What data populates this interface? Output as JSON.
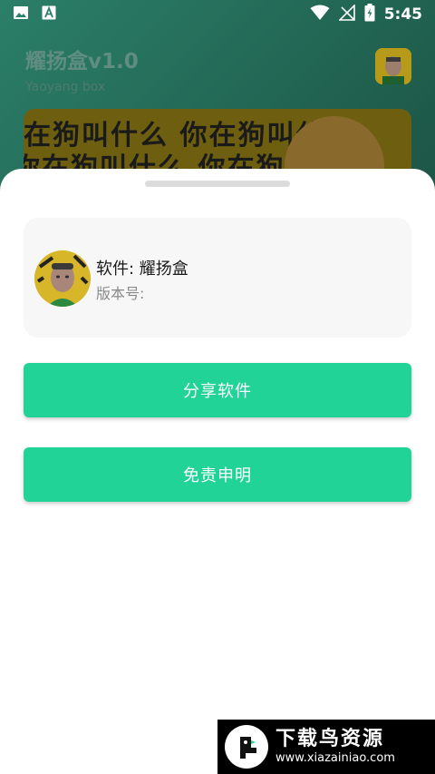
{
  "status_bar": {
    "time": "5:45",
    "icons": [
      "image-icon",
      "text-a-icon",
      "wifi-icon",
      "no-signal-icon",
      "battery-charging-icon"
    ]
  },
  "app": {
    "title": "耀扬盒v1.0",
    "subtitle": "Yaoyang box",
    "banner_lines": [
      "在狗叫什么 你在狗叫什么",
      "你在狗叫什么 你在狗叫什么"
    ]
  },
  "sheet": {
    "app_name": "软件: 耀扬盒",
    "version_label": "版本号:",
    "share_button": "分享软件",
    "disclaimer_button": "免责申明"
  },
  "watermark": {
    "title": "下载鸟资源",
    "url": "www.xiazainiao.com"
  },
  "colors": {
    "accent": "#22d398",
    "card_bg": "#f7f7f7",
    "sheet_bg": "#ffffff"
  }
}
